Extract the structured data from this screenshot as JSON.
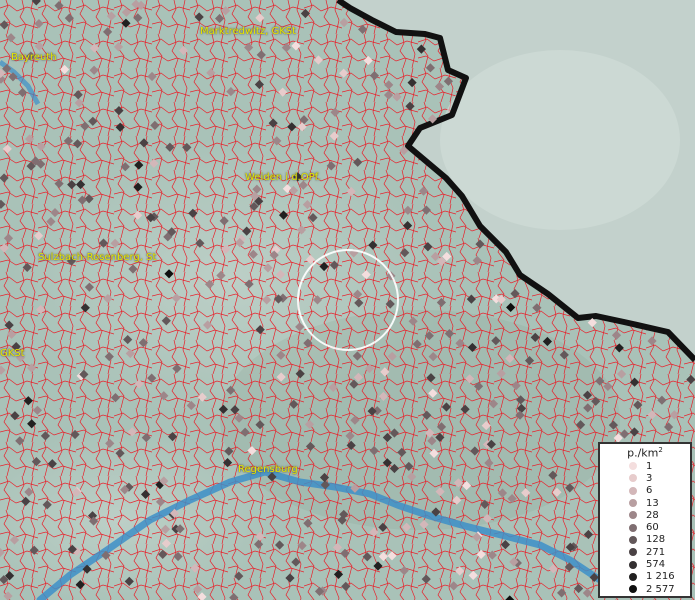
{
  "map": {
    "places": [
      {
        "name": "Marktredwitz, GKSt"
      },
      {
        "name": "Bayreuth"
      },
      {
        "name": "Weiden i.d.OPf."
      },
      {
        "name": "Sulzbach-Rosenberg, St"
      },
      {
        "name": "GKSt"
      },
      {
        "name": "Regensburg"
      }
    ],
    "colors": {
      "terrain": "#a9c2b8",
      "neighbor_country": "#c3d1cc",
      "municipal_borders": "#e8202a",
      "national_border": "#111111",
      "river": "#3d8fc8",
      "label": "#e8e800",
      "highlight_circle": "#ffffff"
    }
  },
  "legend": {
    "title": "p./km",
    "title_sup": "2",
    "items": [
      {
        "label": "1",
        "color": "#f4dede"
      },
      {
        "label": "3",
        "color": "#e7cccc"
      },
      {
        "label": "6",
        "color": "#d3b7b9"
      },
      {
        "label": "13",
        "color": "#b89fa1"
      },
      {
        "label": "28",
        "color": "#9d8689"
      },
      {
        "label": "60",
        "color": "#7f6e71"
      },
      {
        "label": "128",
        "color": "#63585a"
      },
      {
        "label": "271",
        "color": "#4a4244"
      },
      {
        "label": "574",
        "color": "#343031"
      },
      {
        "label": "1 216",
        "color": "#212020"
      },
      {
        "label": "2 577",
        "color": "#0f0f0f"
      }
    ]
  }
}
